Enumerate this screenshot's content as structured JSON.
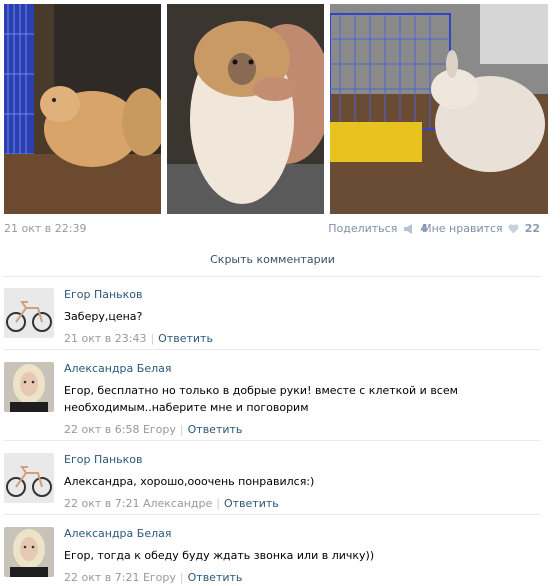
{
  "photos": [
    {
      "desc": "rabbit-in-cage-left"
    },
    {
      "desc": "rabbit-held"
    },
    {
      "desc": "rabbit-by-cage"
    }
  ],
  "post": {
    "date": "21 окт в 22:39",
    "share_label": "Поделиться",
    "share_count": "4",
    "like_label": "Мне нравится",
    "like_count": "22"
  },
  "hide_comments": "Скрыть комментарии",
  "comments": [
    {
      "author": "Егор Паньков",
      "text": "Заберу,цена?",
      "time": "21 окт в 23:43",
      "reply": "Ответить",
      "avatar": "bicycle"
    },
    {
      "author": "Александра Белая",
      "text": "Егор, бесплатно но только в добрые руки! вместе с клеткой и всем необходимым..наберите мне и поговорим",
      "time": "22 окт в 6:58 Егору",
      "reply": "Ответить",
      "avatar": "woman"
    },
    {
      "author": "Егор Паньков",
      "text": "Александра, хорошо,ооочень понравился:)",
      "time": "22 окт в 7:21 Александре",
      "reply": "Ответить",
      "avatar": "bicycle"
    },
    {
      "author": "Александра Белая",
      "text": "Егор, тогда к обеду буду ждать звонка или в личку))",
      "time": "22 окт в 7:21 Егору",
      "reply": "Ответить",
      "avatar": "woman"
    }
  ],
  "colors": {
    "link": "#2b587a",
    "muted": "#999999",
    "share": "#7f8fa6"
  }
}
